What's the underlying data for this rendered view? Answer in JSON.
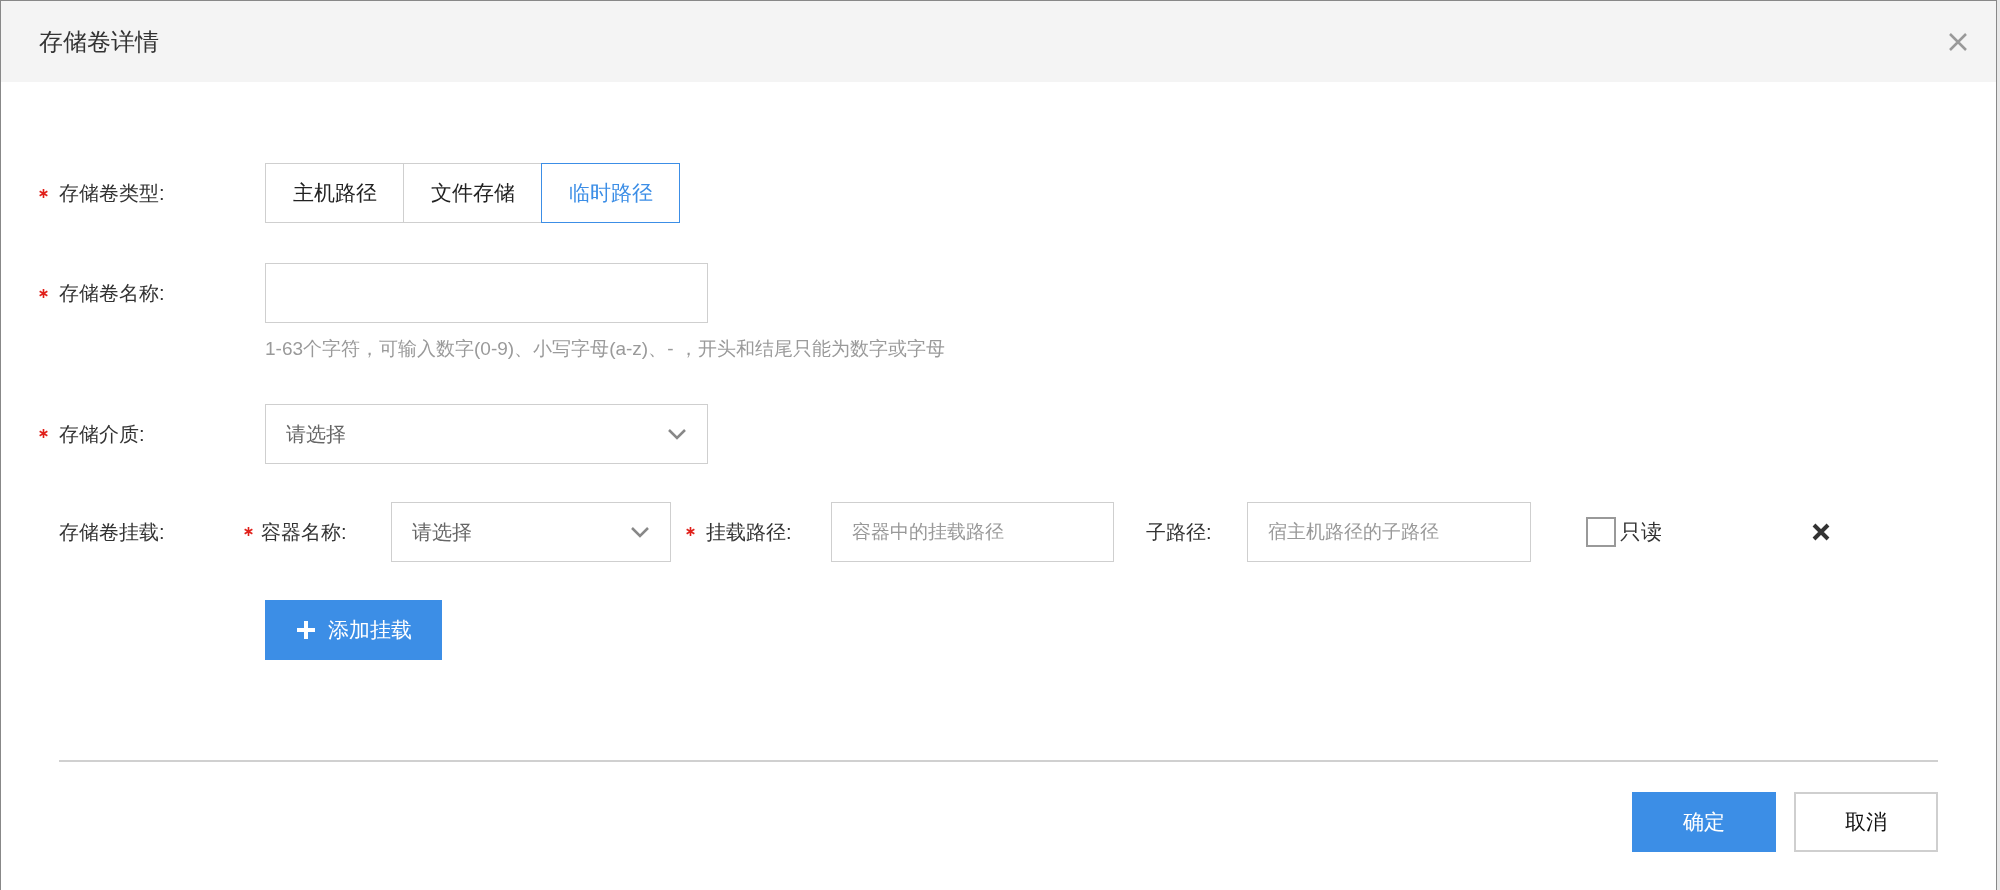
{
  "dialog": {
    "title": "存储卷详情"
  },
  "fields": [
    {
      "kind": "segmented",
      "label": "存储卷类型:",
      "required": true,
      "options": [
        {
          "label": "主机路径",
          "selected": false
        },
        {
          "label": "文件存储",
          "selected": false
        },
        {
          "label": "临时路径",
          "selected": true
        }
      ]
    },
    {
      "kind": "text",
      "label": "存储卷名称:",
      "required": true,
      "hint": "1-63个字符，可输入数字(0-9)、小写字母(a-z)、- ，开头和结尾只能为数字或字母"
    },
    {
      "kind": "select",
      "label": "存储介质:",
      "required": true,
      "placeholder": "请选择"
    }
  ],
  "mount": {
    "label": "存储卷挂载:",
    "container": {
      "label": "容器名称:",
      "required": true,
      "placeholder": "请选择"
    },
    "path": {
      "label": "挂载路径:",
      "required": true,
      "placeholder": "容器中的挂载路径"
    },
    "subpath": {
      "label": "子路径:",
      "required": false,
      "placeholder": "宿主机路径的子路径"
    },
    "readonly": {
      "label": "只读",
      "checked": false
    },
    "add_button": "添加挂载"
  },
  "footer": {
    "buttons": [
      {
        "label": "确定",
        "primary": true
      },
      {
        "label": "取消",
        "primary": false
      }
    ]
  }
}
